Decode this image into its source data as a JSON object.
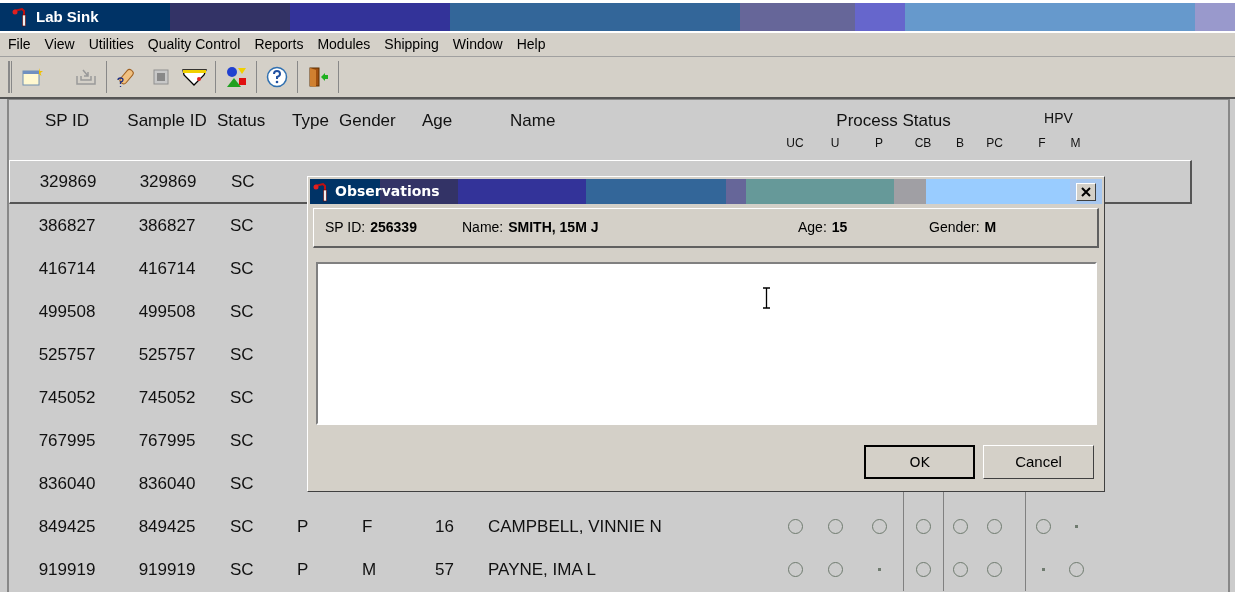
{
  "window": {
    "title": "Lab Sink"
  },
  "menu": [
    "File",
    "View",
    "Utilities",
    "Quality Control",
    "Reports",
    "Modules",
    "Shipping",
    "Window",
    "Help"
  ],
  "table": {
    "columns": [
      "SP ID",
      "Sample ID",
      "Status",
      "Type",
      "Gender",
      "Age",
      "Name"
    ],
    "process_header": "Process Status",
    "hpv_header": "HPV",
    "process_columns": [
      "UC",
      "U",
      "P",
      "CB",
      "B",
      "PC"
    ],
    "hpv_columns": [
      "F",
      "M"
    ],
    "rows": [
      {
        "sp_id": "329869",
        "sample_id": "329869",
        "status": "SC",
        "selected": true
      },
      {
        "sp_id": "386827",
        "sample_id": "386827",
        "status": "SC",
        "selected": false
      },
      {
        "sp_id": "416714",
        "sample_id": "416714",
        "status": "SC",
        "selected": false
      },
      {
        "sp_id": "499508",
        "sample_id": "499508",
        "status": "SC",
        "selected": false
      },
      {
        "sp_id": "525757",
        "sample_id": "525757",
        "status": "SC",
        "selected": false
      },
      {
        "sp_id": "745052",
        "sample_id": "745052",
        "status": "SC",
        "selected": false
      },
      {
        "sp_id": "767995",
        "sample_id": "767995",
        "status": "SC",
        "selected": false
      },
      {
        "sp_id": "836040",
        "sample_id": "836040",
        "status": "SC",
        "selected": false
      },
      {
        "sp_id": "849425",
        "sample_id": "849425",
        "status": "SC",
        "type": "P",
        "gender": "F",
        "age": "16",
        "name": "CAMPBELL, VINNIE N",
        "selected": false,
        "process": [
          {
            "kind": "circle"
          },
          {
            "kind": "circle"
          },
          {
            "kind": "circle"
          },
          {
            "kind": "circle"
          },
          {
            "kind": "circle"
          },
          {
            "kind": "circle"
          }
        ],
        "hpv": [
          {
            "kind": "circle"
          },
          {
            "kind": "dot"
          }
        ]
      },
      {
        "sp_id": "919919",
        "sample_id": "919919",
        "status": "SC",
        "type": "P",
        "gender": "M",
        "age": "57",
        "name": "PAYNE, IMA L",
        "selected": false,
        "process": [
          {
            "kind": "circle"
          },
          {
            "kind": "circle"
          },
          {
            "kind": "dot"
          },
          {
            "kind": "circle"
          },
          {
            "kind": "circle"
          },
          {
            "kind": "circle"
          }
        ],
        "hpv": [
          {
            "kind": "dot"
          },
          {
            "kind": "circle"
          }
        ]
      }
    ]
  },
  "dialog": {
    "title": "Observations",
    "fields": [
      {
        "label": "SP ID:",
        "value": "256339"
      },
      {
        "label": "Name:",
        "value": "SMITH, 15M J"
      },
      {
        "label": "Age:",
        "value": "15"
      },
      {
        "label": "Gender:",
        "value": "M"
      }
    ],
    "buttons": [
      "OK",
      "Cancel"
    ]
  }
}
